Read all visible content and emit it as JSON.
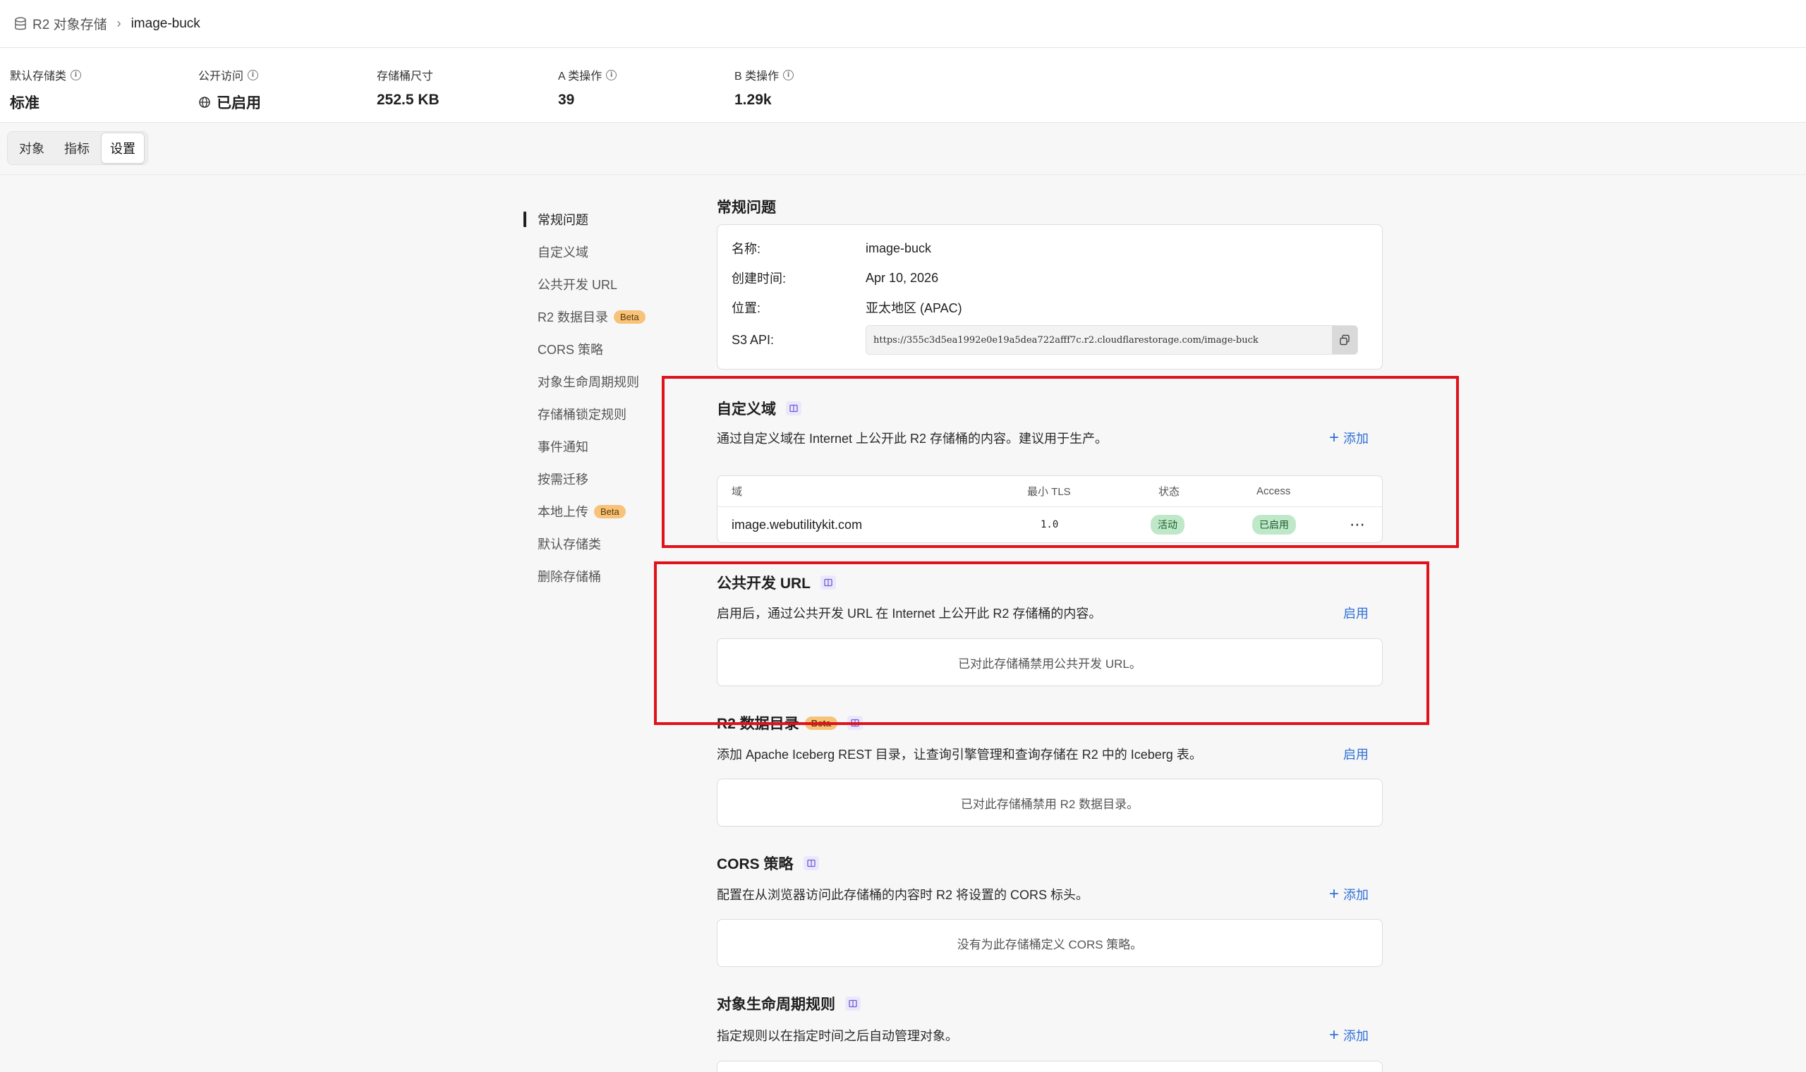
{
  "breadcrumb": {
    "root": "R2 对象存储",
    "separator": "›",
    "current": "image-buck"
  },
  "stats": [
    {
      "label": "默认存储类",
      "value": "标准",
      "has_info": true
    },
    {
      "label": "公开访问",
      "value": "已启用",
      "has_info": true
    },
    {
      "label": "存储桶尺寸",
      "value": "252.5 KB",
      "has_info": false
    },
    {
      "label": "A 类操作",
      "value": "39",
      "has_info": true
    },
    {
      "label": "B 类操作",
      "value": "1.29k",
      "has_info": true
    }
  ],
  "tabs": [
    {
      "label": "对象",
      "active": false
    },
    {
      "label": "指标",
      "active": false
    },
    {
      "label": "设置",
      "active": true
    }
  ],
  "nav": [
    {
      "label": "常规问题",
      "active": true,
      "beta": false
    },
    {
      "label": "自定义域",
      "active": false,
      "beta": false
    },
    {
      "label": "公共开发 URL",
      "active": false,
      "beta": false
    },
    {
      "label": "R2 数据目录",
      "active": false,
      "beta": true
    },
    {
      "label": "CORS 策略",
      "active": false,
      "beta": false
    },
    {
      "label": "对象生命周期规则",
      "active": false,
      "beta": false
    },
    {
      "label": "存储桶锁定规则",
      "active": false,
      "beta": false
    },
    {
      "label": "事件通知",
      "active": false,
      "beta": false
    },
    {
      "label": "按需迁移",
      "active": false,
      "beta": false
    },
    {
      "label": "本地上传",
      "active": false,
      "beta": true
    },
    {
      "label": "默认存储类",
      "active": false,
      "beta": false
    },
    {
      "label": "删除存储桶",
      "active": false,
      "beta": false
    }
  ],
  "beta_label": "Beta",
  "general": {
    "title": "常规问题",
    "name_label": "名称:",
    "name_value": "image-buck",
    "created_label": "创建时间:",
    "created_value": "Apr 10, 2026",
    "location_label": "位置:",
    "location_value": "亚太地区 (APAC)",
    "s3_label": "S3 API:",
    "s3_value": "https://355c3d5ea1992e0e19a5dea722afff7c.r2.cloudflarestorage.com/image-buck"
  },
  "custom_domain": {
    "title": "自定义域",
    "description": "通过自定义域在 Internet 上公开此 R2 存储桶的内容。建议用于生产。",
    "action": "添加",
    "columns": {
      "domain": "域",
      "tls": "最小 TLS",
      "status": "状态",
      "access": "Access"
    },
    "rows": [
      {
        "domain": "image.webutilitykit.com",
        "tls": "1.0",
        "status": "活动",
        "access": "已启用"
      }
    ]
  },
  "public_dev_url": {
    "title": "公共开发 URL",
    "description": "启用后，通过公共开发 URL 在 Internet 上公开此 R2 存储桶的内容。",
    "action": "启用",
    "empty": "已对此存储桶禁用公共开发 URL。"
  },
  "data_catalog": {
    "title": "R2 数据目录",
    "description": "添加 Apache Iceberg REST 目录，让查询引擎管理和查询存储在 R2 中的 Iceberg 表。",
    "action": "启用",
    "empty": "已对此存储桶禁用 R2 数据目录。"
  },
  "cors": {
    "title": "CORS 策略",
    "description": "配置在从浏览器访问此存储桶的内容时 R2 将设置的 CORS 标头。",
    "action": "添加",
    "empty": "没有为此存储桶定义 CORS 策略。"
  },
  "lifecycle": {
    "title": "对象生命周期规则",
    "description": "指定规则以在指定时间之后自动管理对象。",
    "action": "添加"
  },
  "colors": {
    "accent_link": "#2f6fd6",
    "annotation": "#e0121b",
    "beta_badge": "#f7c27a",
    "status_green": "#bfe8c9"
  }
}
